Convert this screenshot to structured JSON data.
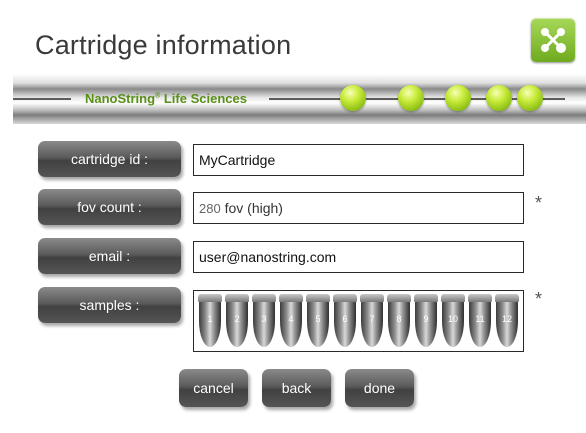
{
  "header": {
    "title": "Cartridge information",
    "logo_icon": "nanostring-network-icon"
  },
  "banner": {
    "brand": "NanoString",
    "brand_reg": "®",
    "brand_suffix": " Life Sciences",
    "progress_steps_total": 5,
    "accent_color": "#9cc927"
  },
  "form": {
    "cartridge_id": {
      "label": "cartridge id :",
      "value": "MyCartridge"
    },
    "fov_count": {
      "label": "fov count :",
      "value_number": "280",
      "value_text": " fov (high)",
      "required_mark": "*"
    },
    "email": {
      "label": "email :",
      "value": "user@nanostring.com"
    },
    "samples": {
      "label": "samples :",
      "required_mark": "*",
      "tubes": [
        "1",
        "2",
        "3",
        "4",
        "5",
        "6",
        "7",
        "8",
        "9",
        "10",
        "11",
        "12"
      ]
    }
  },
  "buttons": {
    "cancel": "cancel",
    "back": "back",
    "done": "done"
  }
}
